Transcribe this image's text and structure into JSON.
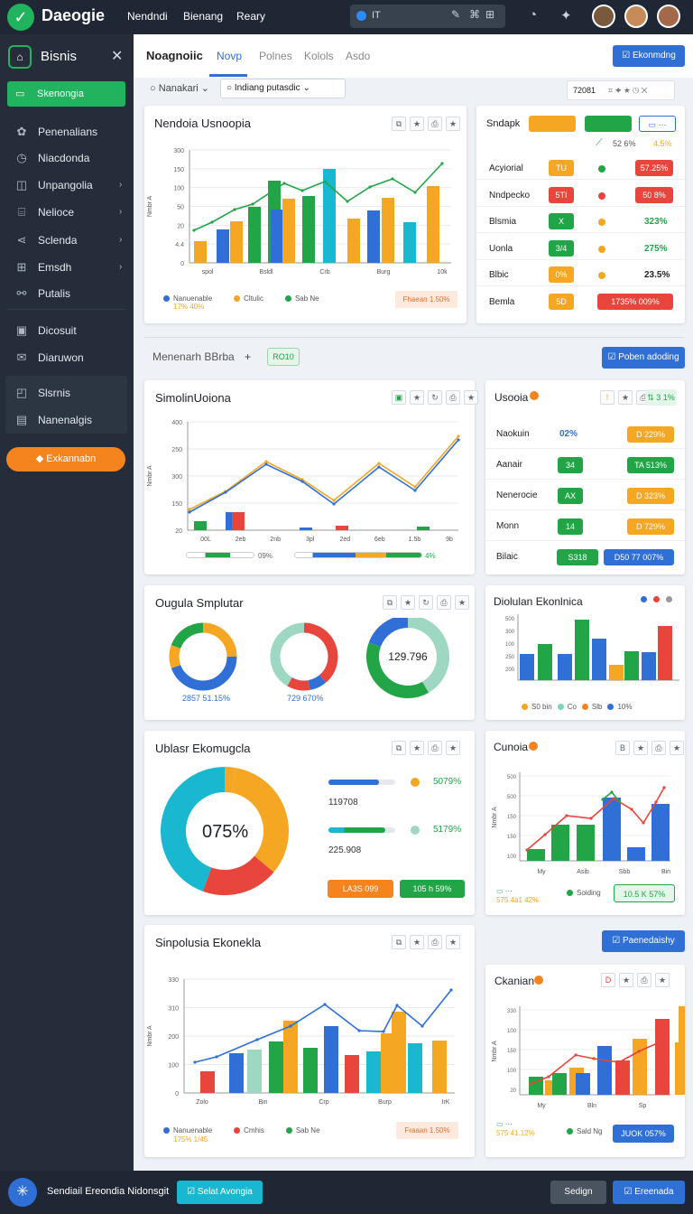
{
  "app": {
    "name": "Daeogie",
    "nav": [
      "Nendndi",
      "Bienang",
      "Reary"
    ],
    "search": "IT"
  },
  "sidebar": {
    "title": "Bisnis",
    "active": "Skenongia",
    "items": [
      "Penenalians",
      "Niacdonda",
      "Unpangolia",
      "Nelioce",
      "Sclenda",
      "Emsdh",
      "Putalis",
      "Dicosuit",
      "Diaruwon"
    ],
    "sub": [
      "Slsrnis",
      "Nanenalgis"
    ],
    "cta": "Exkannabn"
  },
  "header": {
    "title": "Noagnoiic",
    "tabs": [
      "Novp",
      "Polnes",
      "Kolols",
      "Asdo"
    ],
    "button": "Ekonmdng",
    "filter1": "Nanakari",
    "filter2": "Indiang putasdic",
    "date": "72081"
  },
  "card1": {
    "title": "Nendoia Usnoopia",
    "y_ticks": [
      "300",
      "150",
      "100",
      "50",
      "20",
      "4.4",
      "0"
    ],
    "ylabel": "Nmbr A",
    "x_ticks": [
      "spol",
      "Bsldl",
      "Crb",
      "Burg",
      "10k"
    ],
    "legend": [
      "Nanuenable",
      "Cltulic",
      "Sab Ne"
    ],
    "legend_sub": "17% 40%",
    "badge": "Fhaean 1.50%"
  },
  "table1": {
    "title": "Sndapk",
    "hdr_vals": [
      "52 6%",
      "4.5%"
    ],
    "rows": [
      {
        "label": "Acyiorial",
        "b": "TU",
        "v": "57.25%"
      },
      {
        "label": "Nndpecko",
        "b": "5TI",
        "v": "50 8%"
      },
      {
        "label": "Blsmia",
        "b": "X",
        "v": "323%"
      },
      {
        "label": "Uonla",
        "b": "3/4",
        "v": "275%"
      },
      {
        "label": "Blbic",
        "b": "0%",
        "v": "23.5%"
      },
      {
        "label": "Bemla",
        "b": "5D",
        "v": "1735% 009%"
      }
    ]
  },
  "section": {
    "title": "Menenarh BBrba",
    "tag": "RO10",
    "button": "Poben adoding"
  },
  "card2": {
    "title": "SimolinUoiona",
    "ylabel": "Nmbr A",
    "y_ticks": [
      "400",
      "250",
      "300",
      "150",
      "20"
    ],
    "x_ticks": [
      "00L",
      "2eb",
      "2nb",
      "3pl",
      "2ed",
      "6eb",
      "1.5b",
      "9b"
    ],
    "foot": [
      "09%",
      "4%"
    ]
  },
  "table2": {
    "title": "Usooia",
    "hdr": "3 1%",
    "rows": [
      {
        "label": "Naokuin",
        "a": "02%",
        "b": "D 229%"
      },
      {
        "label": "Aanair",
        "a": "34",
        "b": "TA 513%"
      },
      {
        "label": "Nenerocie",
        "a": "AX",
        "b": "D 323%"
      },
      {
        "label": "Monn",
        "a": "14",
        "b": "D 729%"
      },
      {
        "label": "Bilaic",
        "a": "S318",
        "b": "D50 77 007%"
      }
    ]
  },
  "donuts": {
    "title": "Ougula Smplutar",
    "labels": [
      "2857 51.15%",
      "729 670%",
      "129.796"
    ]
  },
  "bar3": {
    "title": "Diolulan Ekonlnica",
    "y_ticks": [
      "500",
      "300",
      "100",
      "250",
      "200"
    ],
    "legend": [
      "S0 bin",
      "Co",
      "Slb",
      "10%"
    ]
  },
  "big": {
    "title": "Ublasr Ekomugcla",
    "center": "075%",
    "v1": "119708",
    "v2": "225.908",
    "p1": "5079%",
    "p2": "5179%",
    "b1": "LA3S 099",
    "b2": "105 h 59%"
  },
  "card5": {
    "title": "Cunoia",
    "y_ticks": [
      "500",
      "500",
      "150",
      "150",
      "100"
    ],
    "x_ticks": [
      "My",
      "Asib",
      "Sbb",
      "Bin"
    ],
    "legend": [
      "Soiding"
    ],
    "sub": "575 4a1 42%",
    "badge": "10.5 K 57%"
  },
  "card6": {
    "title": "Sinpolusia Ekonekla",
    "ylabel": "Nmbr A",
    "y_ticks": [
      "330",
      "310",
      "200",
      "100",
      "0"
    ],
    "x_ticks": [
      "Zolo",
      "Bin",
      "Crp",
      "Burp",
      "IrK"
    ],
    "legend": [
      "Nanuenable",
      "Cmhis",
      "Sab Ne"
    ],
    "legend_sub": "175% 1/45",
    "badge": "Fraaan 1.50%",
    "button": "Paenedaishy"
  },
  "card7": {
    "title": "Ckanian",
    "y_ticks": [
      "330",
      "100",
      "150",
      "100",
      "20"
    ],
    "x_ticks": [
      "My",
      "Bln",
      "Sp"
    ],
    "legend": [
      "Sald Ng"
    ],
    "sub": "575 41.12%",
    "badge": "JUOK 057%"
  },
  "footer": {
    "text": "Sendiail Ereondia Nidonsgit",
    "b1": "Selat Avongia",
    "b2": "Sedign",
    "b3": "Ereenada"
  },
  "colors": {
    "blue": "#2f6fd6",
    "green": "#22a547",
    "orange": "#f5a623",
    "red": "#e8453c",
    "teal": "#1ab8d0"
  }
}
